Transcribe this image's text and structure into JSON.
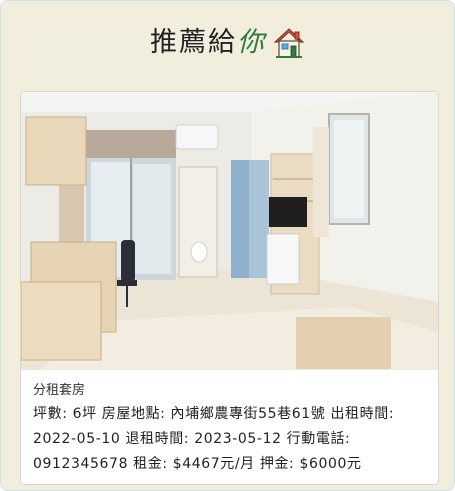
{
  "header": {
    "title_main": "推薦給",
    "title_accent": "你",
    "title_icon": "house-icon"
  },
  "listing": {
    "category": "分租套房",
    "photo_icon": "room-photo",
    "area_label": "坪數:",
    "area_value": "6坪",
    "address_label": "房屋地點:",
    "address_value": "內埔鄉農專街55巷61號",
    "rent_start_label": "出租時間:",
    "rent_start_value": "2022-05-10",
    "rent_end_label": "退租時間:",
    "rent_end_value": "2023-05-12",
    "phone_label": "行動電話:",
    "phone_value": "0912345678",
    "rent_label": "租金:",
    "rent_value": "$4467元/月",
    "deposit_label": "押金:",
    "deposit_value": "$6000元"
  },
  "colors": {
    "panel_bg": "#f1eedd",
    "accent": "#2f7a3c",
    "roof": "#e0523b"
  }
}
